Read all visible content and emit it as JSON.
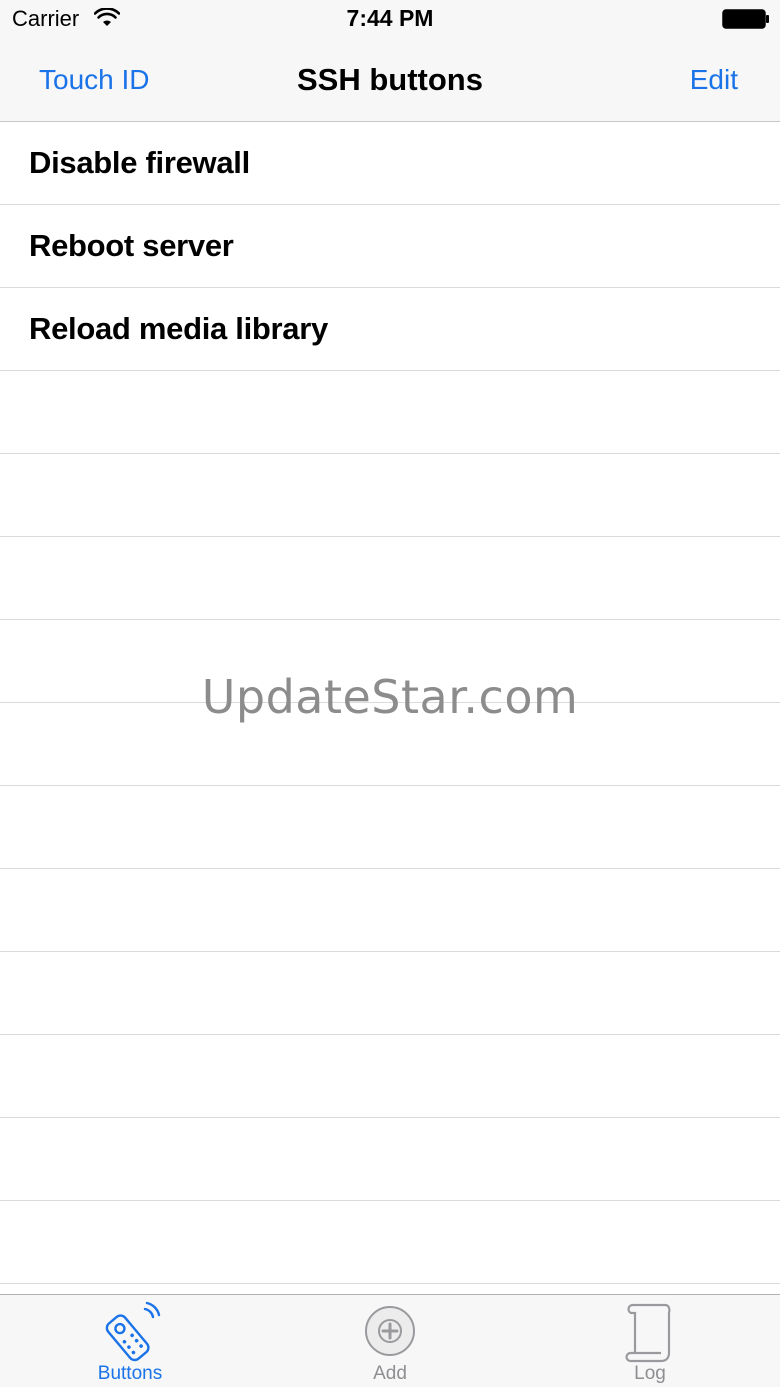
{
  "status_bar": {
    "carrier": "Carrier",
    "time": "7:44 PM"
  },
  "nav_bar": {
    "left_button": "Touch ID",
    "title": "SSH buttons",
    "right_button": "Edit"
  },
  "buttons_list": [
    {
      "label": "Disable firewall"
    },
    {
      "label": "Reboot server"
    },
    {
      "label": "Reload media library"
    },
    {
      "label": ""
    },
    {
      "label": ""
    },
    {
      "label": ""
    },
    {
      "label": ""
    },
    {
      "label": ""
    },
    {
      "label": ""
    },
    {
      "label": ""
    },
    {
      "label": ""
    },
    {
      "label": ""
    },
    {
      "label": ""
    },
    {
      "label": ""
    }
  ],
  "watermark": "UpdateStar.com",
  "tab_bar": {
    "tabs": [
      {
        "label": "Buttons",
        "icon": "remote-icon",
        "active": true
      },
      {
        "label": "Add",
        "icon": "add-circle-icon",
        "active": false
      },
      {
        "label": "Log",
        "icon": "scroll-icon",
        "active": false
      }
    ]
  },
  "colors": {
    "accent": "#1a73e8",
    "inactive": "#8e8e93",
    "bar_background": "#f7f7f7",
    "separator": "#d9d9de"
  }
}
